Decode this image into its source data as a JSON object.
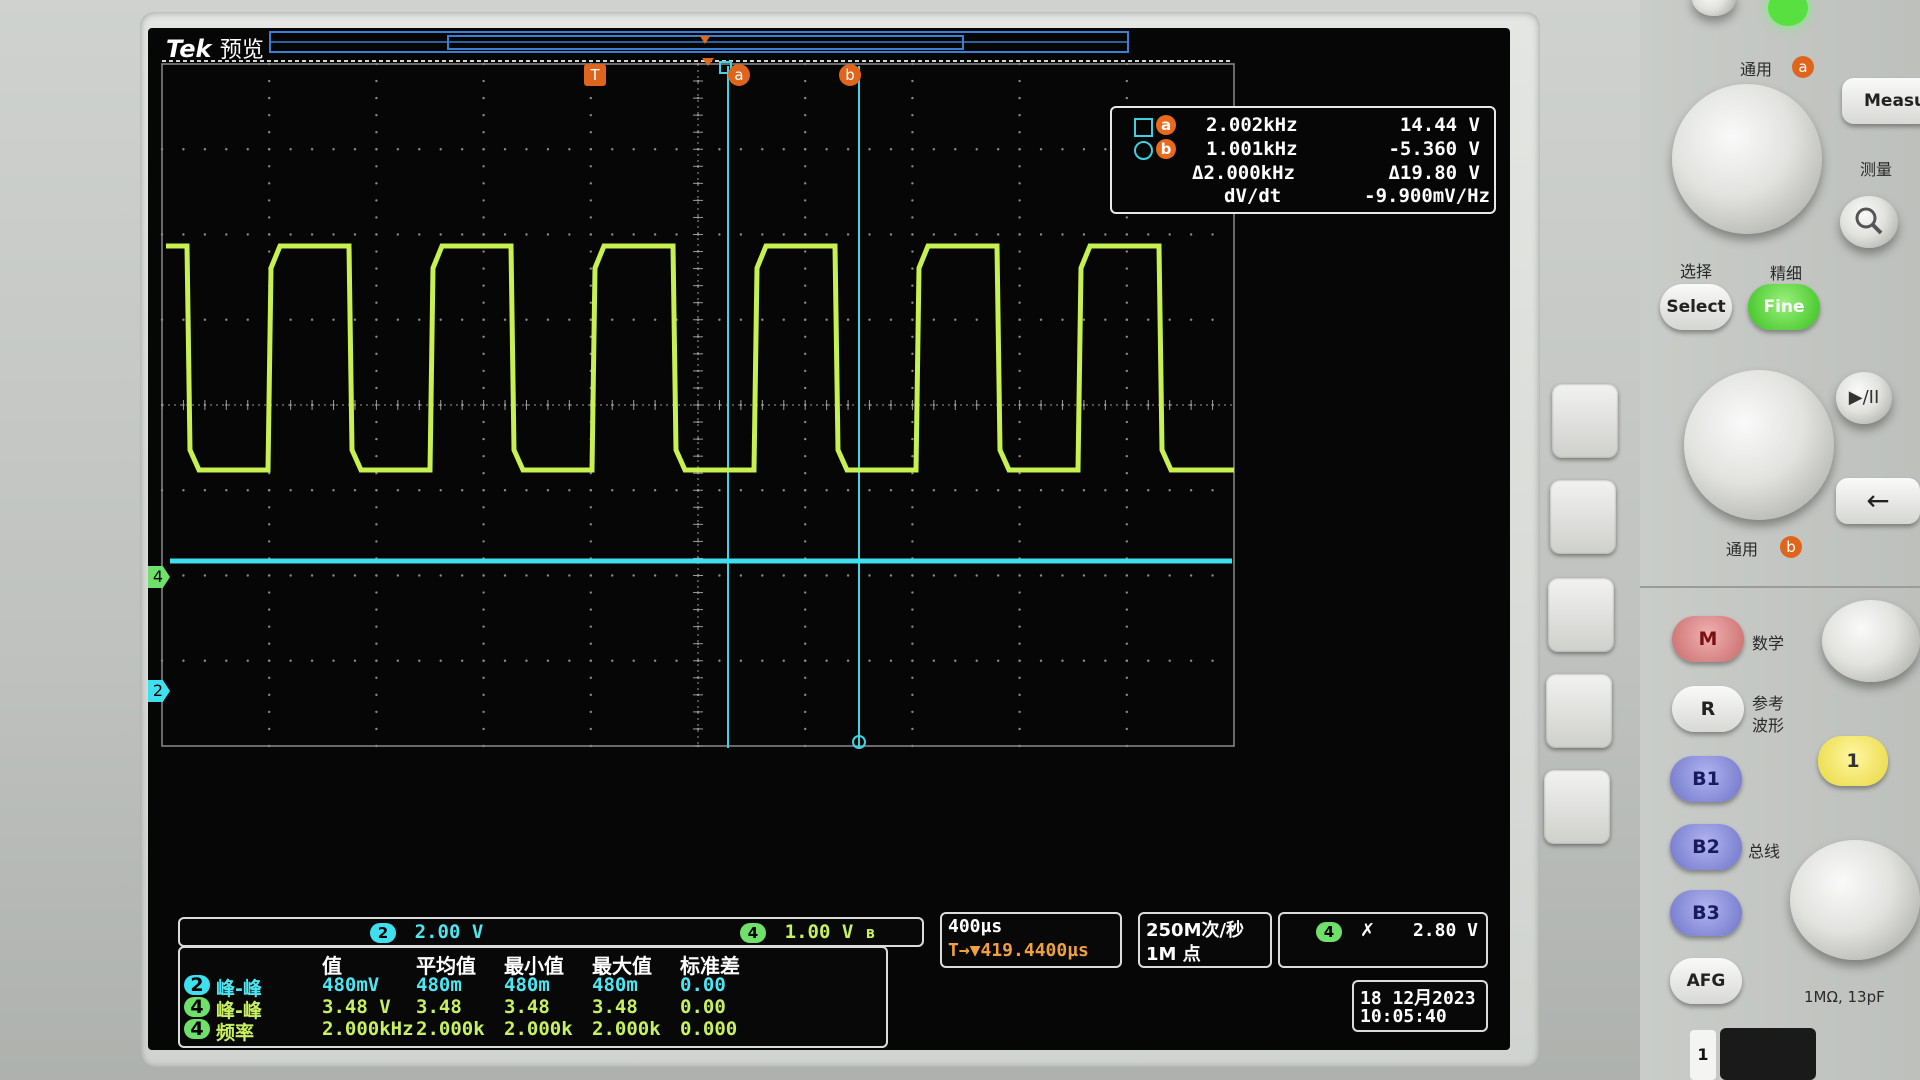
{
  "header": {
    "brand": "Tek",
    "mode": "预览"
  },
  "cursors": {
    "a_label": "a",
    "b_label": "b",
    "a_freq": "2.002kHz",
    "a_volt": "14.44 V",
    "b_freq": "1.001kHz",
    "b_volt": "-5.360 V",
    "delta_freq": "Δ2.000kHz",
    "delta_volt": "Δ19.80 V",
    "dvdt_label": "dV/dt",
    "dvdt_value": "-9.900mV/Hz"
  },
  "markers": {
    "trigger": "T",
    "ch4": "4",
    "ch2": "2"
  },
  "channels": {
    "ch2_badge": "2",
    "ch2_scale": "2.00 V",
    "ch4_badge": "4",
    "ch4_scale": "1.00 V",
    "bw_mark": "B",
    "ch2_color": "#3ee0f0",
    "ch4_color": "#c8f050"
  },
  "timebase": {
    "scale": "400µs",
    "trigger_pos": "T→▼419.4400µs",
    "sample_rate": "250M次/秒",
    "record_length": "1M 点",
    "trigger_ch": "4",
    "trigger_slope": "✗",
    "trigger_level": "2.80 V"
  },
  "datetime": {
    "date": "18 12月2023",
    "time": "10:05:40"
  },
  "measurements": {
    "headers": [
      "值",
      "平均值",
      "最小值",
      "最大值",
      "标准差"
    ],
    "rows": [
      {
        "ch": "2",
        "name": "峰-峰",
        "value": "480mV",
        "mean": "480m",
        "min": "480m",
        "max": "480m",
        "std": "0.00"
      },
      {
        "ch": "4",
        "name": "峰-峰",
        "value": "3.48 V",
        "mean": "3.48",
        "min": "3.48",
        "max": "3.48",
        "std": "0.00"
      },
      {
        "ch": "4",
        "name": "频率",
        "value": "2.000kHz",
        "mean": "2.000k",
        "min": "2.000k",
        "max": "2.000k",
        "std": "0.000"
      }
    ]
  },
  "panel": {
    "general_a": "通用",
    "a_tag": "a",
    "measure_btn": "Measur",
    "measure_label": "测量",
    "select_label": "选择",
    "select_btn": "Select",
    "fine_label": "精细",
    "fine_btn": "Fine",
    "play_glyph": "▶/II",
    "back_glyph": "←",
    "general_b": "通用",
    "b_tag": "b",
    "m_btn": "M",
    "m_label": "数学",
    "r_btn": "R",
    "r_label1": "参考",
    "r_label2": "波形",
    "b1_btn": "B1",
    "b2_btn": "B2",
    "b3_btn": "B3",
    "bus_label": "总线",
    "ch1_btn": "1",
    "afg_btn": "AFG",
    "impedance": "1MΩ, 13pF",
    "bottom_num": "1"
  }
}
